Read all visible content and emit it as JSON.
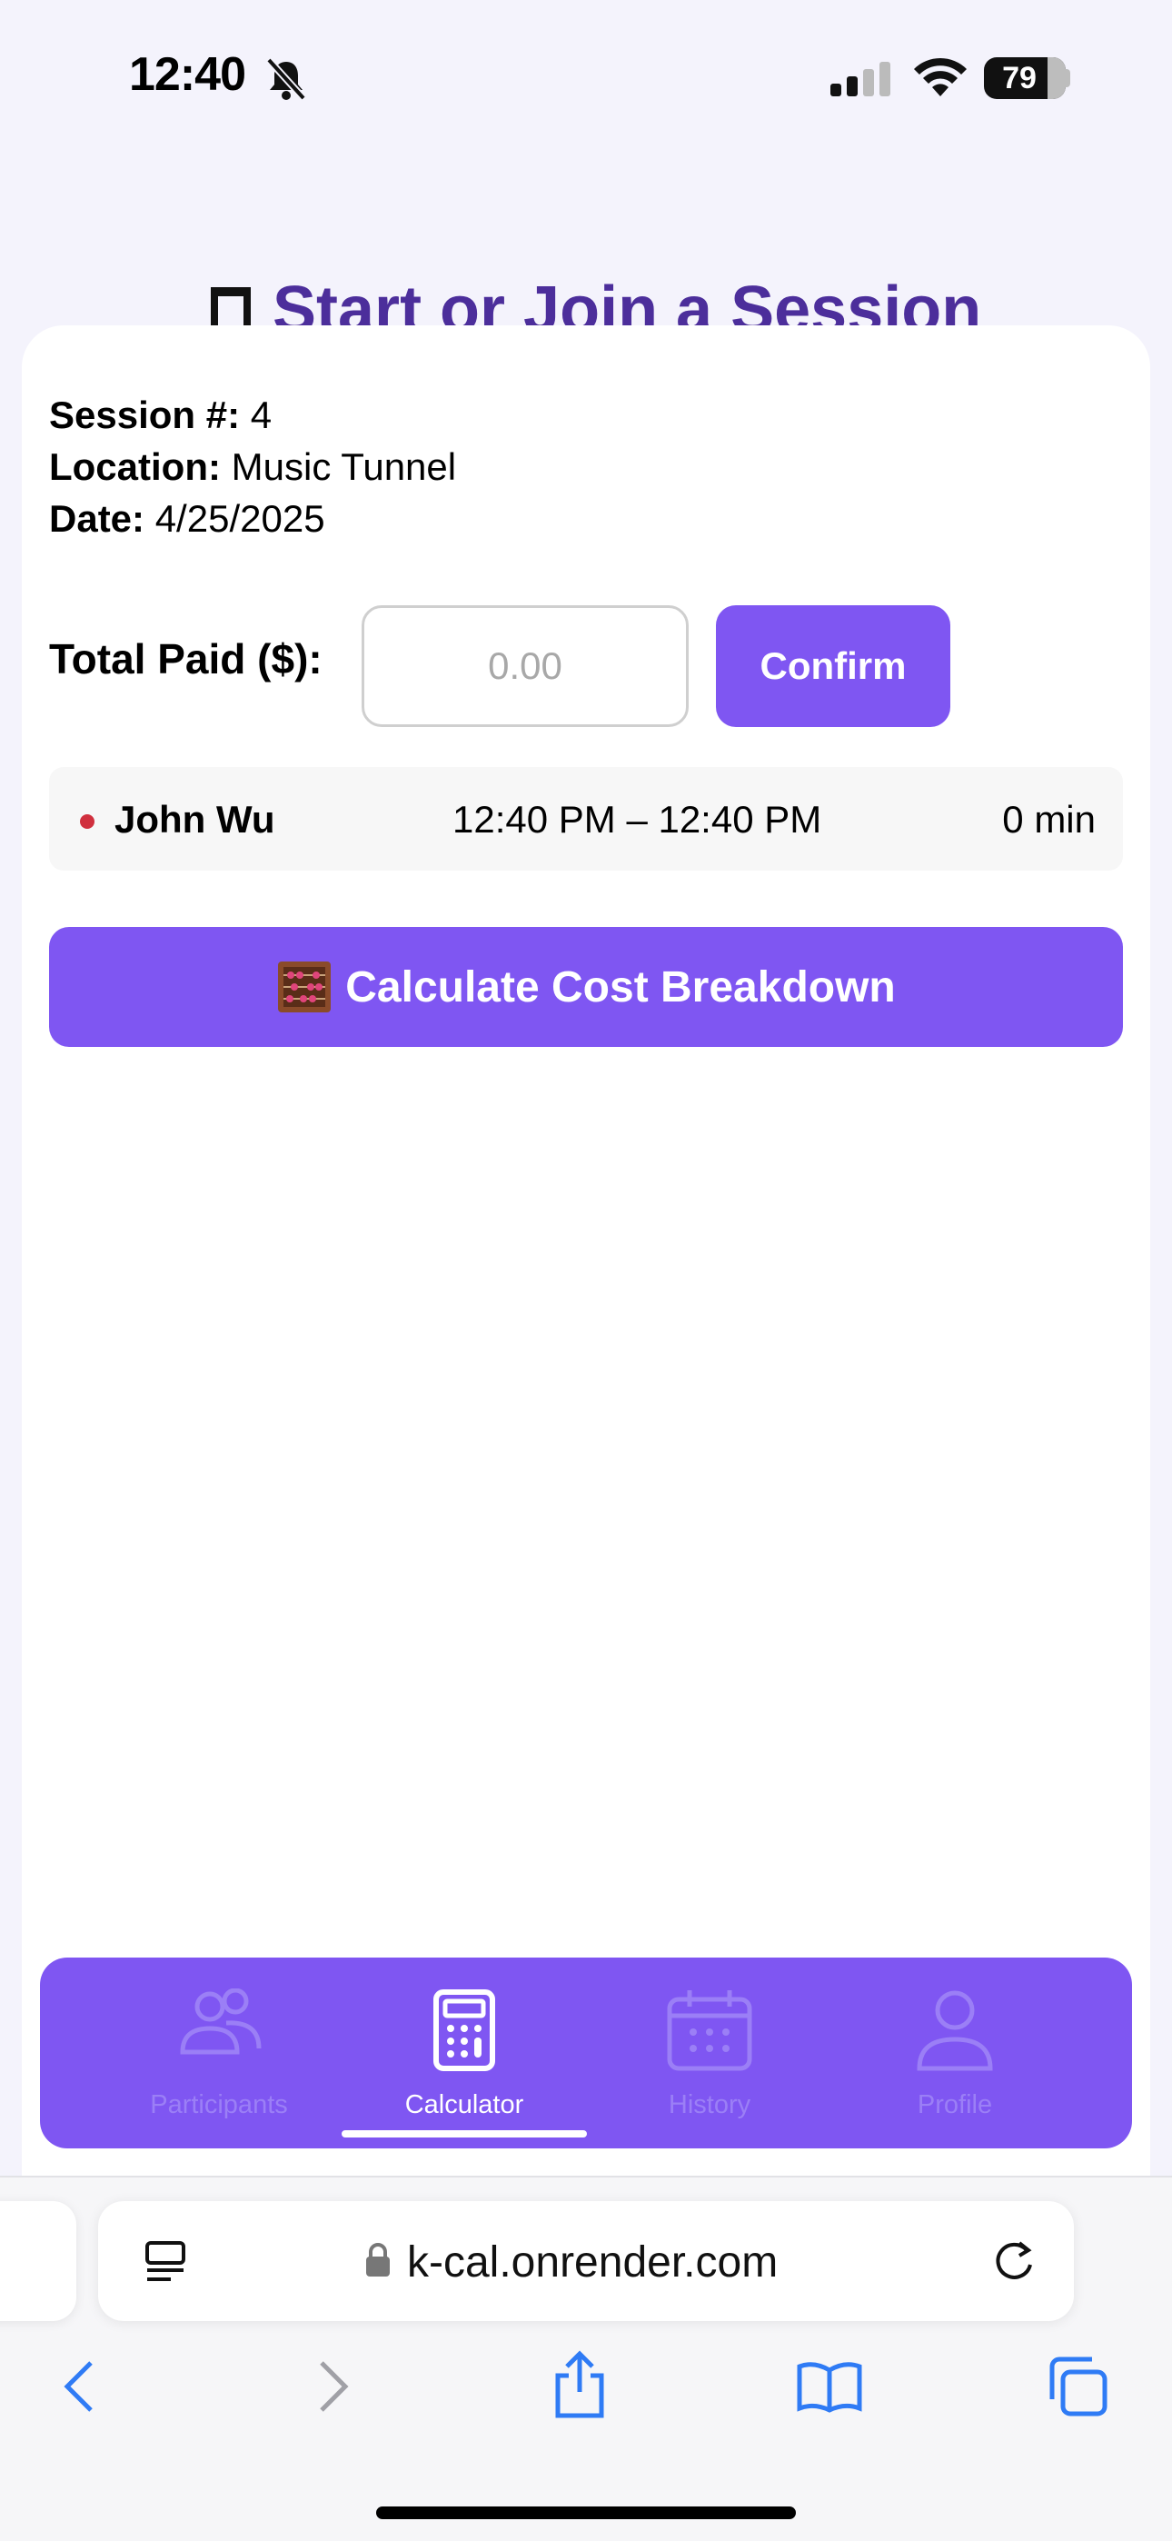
{
  "status_bar": {
    "time": "12:40",
    "battery": "79"
  },
  "page": {
    "heading": "Start or Join a Session"
  },
  "session": {
    "number_label": "Session #:",
    "number_value": "4",
    "location_label": "Location:",
    "location_value": "Music Tunnel",
    "date_label": "Date:",
    "date_value": "4/25/2025"
  },
  "payment": {
    "label": "Total Paid ($):",
    "placeholder": "0.00",
    "confirm_label": "Confirm"
  },
  "participants": [
    {
      "name": "John Wu",
      "time_range": "12:40 PM – 12:40 PM",
      "duration": "0 min",
      "status_color": "#d0303e"
    }
  ],
  "calculate_label": "Calculate Cost Breakdown",
  "nav": {
    "items": [
      {
        "label": "Participants",
        "icon": "people-icon",
        "active": false
      },
      {
        "label": "Calculator",
        "icon": "calculator-icon",
        "active": true
      },
      {
        "label": "History",
        "icon": "calendar-icon",
        "active": false
      },
      {
        "label": "Profile",
        "icon": "person-icon",
        "active": false
      }
    ]
  },
  "browser": {
    "url": "k-cal.onrender.com"
  },
  "colors": {
    "accent": "#7f56f2",
    "heading": "#4c2e9b",
    "background": "#f4f3fc"
  }
}
